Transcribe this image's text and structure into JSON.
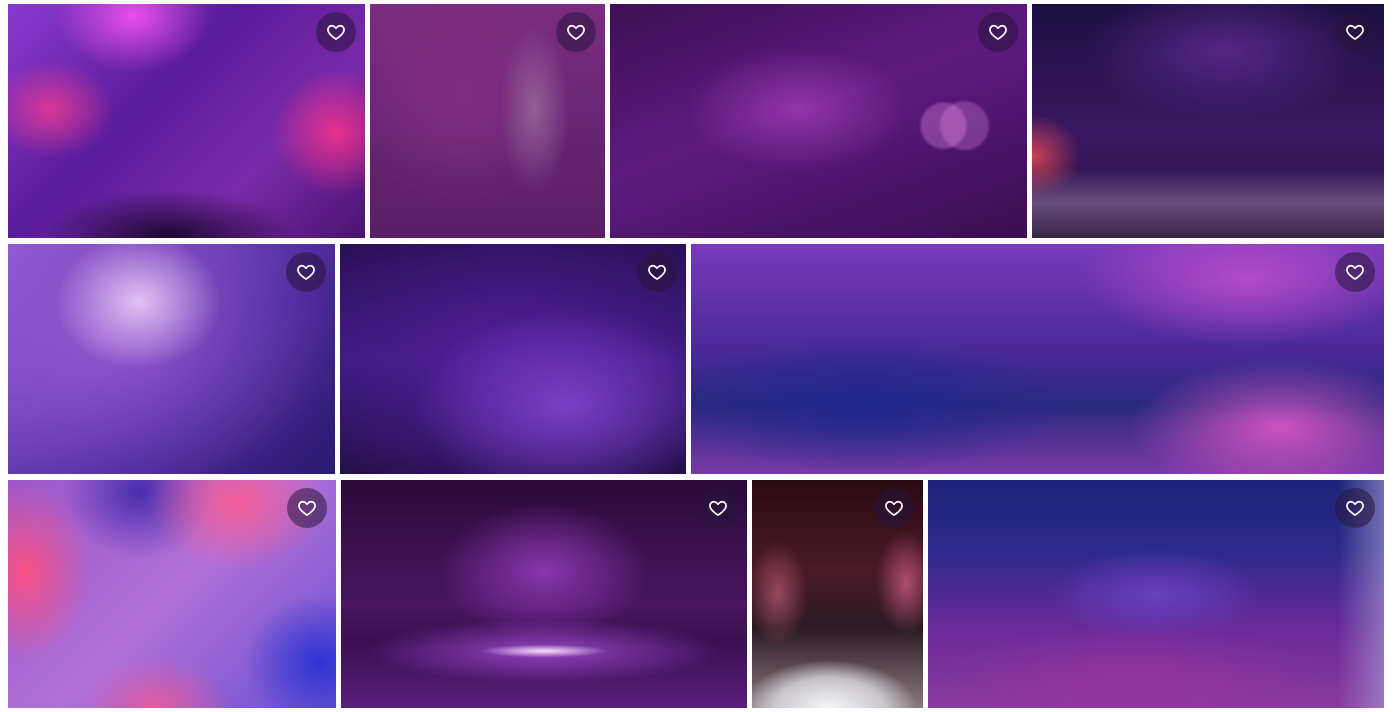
{
  "gallery": {
    "tiles": [
      {
        "id": "t1",
        "favorite_icon": "heart-outline-icon",
        "colors": [
          "#8a3ad0",
          "#ff3c8c"
        ]
      },
      {
        "id": "t2",
        "favorite_icon": "heart-outline-icon",
        "colors": [
          "#7a2c80"
        ]
      },
      {
        "id": "t3",
        "favorite_icon": "heart-outline-icon",
        "colors": [
          "#5e1a80"
        ]
      },
      {
        "id": "t4",
        "favorite_icon": "heart-outline-icon",
        "colors": [
          "#3a1862"
        ]
      },
      {
        "id": "t5",
        "favorite_icon": "heart-outline-icon",
        "colors": [
          "#8e5ad0"
        ]
      },
      {
        "id": "t6",
        "favorite_icon": "heart-outline-icon",
        "colors": [
          "#3e1a80"
        ]
      },
      {
        "id": "t7",
        "favorite_icon": "heart-outline-icon",
        "colors": [
          "#4a2a98",
          "#e65ac8"
        ]
      },
      {
        "id": "t8",
        "favorite_icon": "heart-outline-icon",
        "colors": [
          "#ff5082",
          "#2832d2"
        ]
      },
      {
        "id": "t9",
        "favorite_icon": "heart-outline-icon",
        "colors": [
          "#4a1660"
        ]
      },
      {
        "id": "t10",
        "favorite_icon": "heart-outline-icon",
        "colors": [
          "#2a0a12",
          "#f5f5f8"
        ]
      },
      {
        "id": "t11",
        "favorite_icon": "heart-outline-icon",
        "colors": [
          "#1e247a",
          "#8a3aa0"
        ]
      }
    ]
  }
}
